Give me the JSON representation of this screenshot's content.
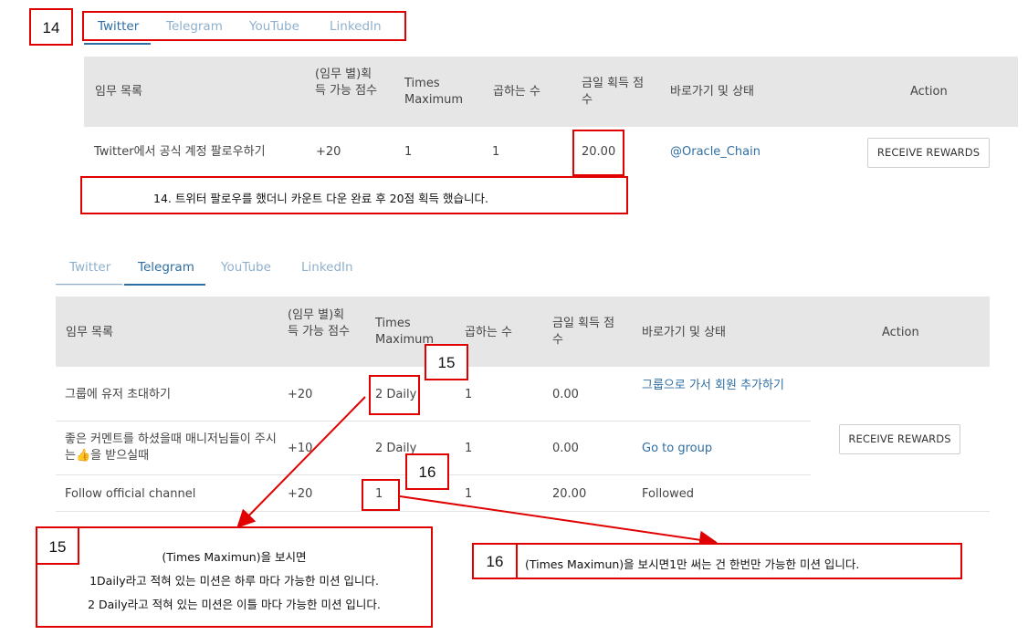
{
  "section1": {
    "tabs": [
      {
        "label": "Twitter",
        "active": true
      },
      {
        "label": "Telegram",
        "active": false
      },
      {
        "label": "YouTube",
        "active": false
      },
      {
        "label": "LinkedIn",
        "active": false
      }
    ],
    "headers": {
      "task": "임무 목록",
      "points": "(임무 별)획득 가능 점수",
      "times": "Times Maximum",
      "multiplier": "곱하는 수",
      "today": "금일 획득 점수",
      "shortcut": "바로가기 및 상태",
      "action": "Action"
    },
    "row": {
      "task": "Twitter에서 공식 계정 팔로우하기",
      "points": "+20",
      "times": "1",
      "multiplier": "1",
      "today": "20.00",
      "shortcut": "@Oracle_Chain"
    },
    "button": "RECEIVE REWARDS"
  },
  "section2": {
    "tabs": [
      {
        "label": "Twitter",
        "active": false
      },
      {
        "label": "Telegram",
        "active": true
      },
      {
        "label": "YouTube",
        "active": false
      },
      {
        "label": "LinkedIn",
        "active": false
      }
    ],
    "headers": {
      "task": "임무 목록",
      "points": "(임무 별)획득 가능 점수",
      "times": "Times Maximum",
      "multiplier": "곱하는 수",
      "today": "금일 획득 점수",
      "shortcut": "바로가기 및 상태",
      "action": "Action"
    },
    "rows": [
      {
        "task": "그룹에 유저 초대하기",
        "points": "+20",
        "times": "2 Daily",
        "multiplier": "1",
        "today": "0.00",
        "shortcut": "그룹으로 가서 회원 추가하기"
      },
      {
        "task": "좋은 커멘트를 하셨을때 매니저님들이 주시는👍을 받으실때",
        "points": "+10",
        "times": "2 Daily",
        "multiplier": "1",
        "today": "0.00",
        "shortcut": "Go to group"
      },
      {
        "task": "Follow official channel",
        "points": "+20",
        "times": "1",
        "multiplier": "1",
        "today": "20.00",
        "shortcut": "Followed"
      }
    ],
    "button": "RECEIVE REWARDS"
  },
  "annotations": {
    "n14": "14",
    "n15": "15",
    "n16": "16",
    "note14": "14. 트위터 팔로우를 했더니 카운트 다운 완료 후  20점 획득 했습니다.",
    "note15_line1": "(Times Maximun)을 보시면",
    "note15_line2": "1Daily라고 적혀 있는 미션은 하루 마다 가능한 미션 입니다.",
    "note15_line3": "2 Daily라고 적혀 있는 미션은 이틀 마다 가능한 미션 입니다.",
    "note16": "(Times Maximun)을 보시면1만 써는 건 한번만 가능한 미션 입니다.",
    "color_red": "#e00000"
  }
}
